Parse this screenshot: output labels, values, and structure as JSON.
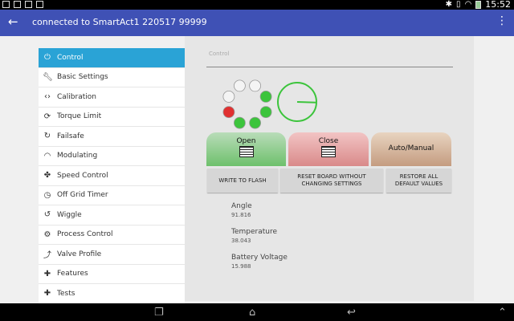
{
  "status_bar": {
    "time": "15:52",
    "icons": [
      "image-icon",
      "gallery-icon",
      "calendar-icon",
      "flag-icon",
      "bluetooth-icon",
      "vibrate-icon",
      "wifi-icon",
      "battery-icon"
    ]
  },
  "action_bar": {
    "title": "connected to SmartAct1 220517 99999"
  },
  "sidebar": {
    "items": [
      {
        "label": "Control",
        "icon": "power-icon",
        "active": true
      },
      {
        "label": "Basic Settings",
        "icon": "wrench-icon"
      },
      {
        "label": "Calibration",
        "icon": "code-icon"
      },
      {
        "label": "Torque Limit",
        "icon": "refresh-icon"
      },
      {
        "label": "Failsafe",
        "icon": "failsafe-icon"
      },
      {
        "label": "Modulating",
        "icon": "wifi-icon"
      },
      {
        "label": "Speed Control",
        "icon": "fan-icon"
      },
      {
        "label": "Off Grid Timer",
        "icon": "timer-icon"
      },
      {
        "label": "Wiggle",
        "icon": "wiggle-icon"
      },
      {
        "label": "Process Control",
        "icon": "settings-icon"
      },
      {
        "label": "Valve Profile",
        "icon": "trend-icon"
      },
      {
        "label": "Features",
        "icon": "puzzle-icon"
      },
      {
        "label": "Tests",
        "icon": "puzzle-icon"
      }
    ]
  },
  "control": {
    "input_placeholder": "Control",
    "valve_leds": [
      "off",
      "off",
      "green",
      "green",
      "green",
      "green",
      "red",
      "off"
    ],
    "gauge_angle_deg": 91.816,
    "buttons": {
      "open": "Open",
      "close": "Close",
      "auto_manual": "Auto/Manual"
    },
    "actions": {
      "write": "WRITE TO FLASH",
      "reset": "RESET BOARD WITHOUT CHANGING SETTINGS",
      "restore": "RESTORE ALL DEFAULT VALUES"
    },
    "readouts": [
      {
        "label": "Angle",
        "value": "91.816"
      },
      {
        "label": "Temperature",
        "value": "38.043"
      },
      {
        "label": "Battery Voltage",
        "value": "15.988"
      }
    ]
  },
  "colors": {
    "action_bar": "#3f51b5",
    "active_nav": "#2aa3d6",
    "led_green": "#3cc43c",
    "led_red": "#e03030",
    "gauge": "#3cc43c"
  }
}
